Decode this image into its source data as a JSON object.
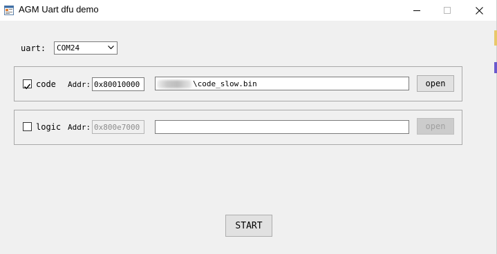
{
  "window": {
    "title": "AGM Uart dfu demo",
    "icons": {
      "app": "form-icon",
      "minimize": "minimize-icon",
      "maximize": "maximize-icon",
      "close": "close-icon"
    }
  },
  "uart": {
    "label": "uart:",
    "selected": "COM24"
  },
  "code_group": {
    "checkbox_label": "code",
    "checked": true,
    "addr_label": "Addr:",
    "addr_value": "0x80010000",
    "path_value": "\\code_slow.bin",
    "path_prefix_redacted": true,
    "open_label": "open",
    "open_enabled": true
  },
  "logic_group": {
    "checkbox_label": "logic",
    "checked": false,
    "addr_label": "Addr:",
    "addr_value": "0x800e7000",
    "path_value": "",
    "open_label": "open",
    "open_enabled": false
  },
  "start_label": "START",
  "colors": {
    "window_bg": "#f0f0f0",
    "titlebar_bg": "#ffffff",
    "button_bg": "#e1e1e1",
    "disabled_button_bg": "#cccccc"
  }
}
